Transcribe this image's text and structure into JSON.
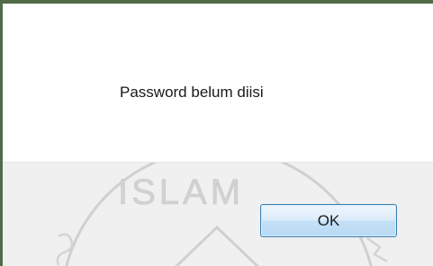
{
  "dialog": {
    "message": "Password belum diisi",
    "ok_label": "OK",
    "watermark_text": "ISLAM"
  },
  "colors": {
    "frame_border": "#4f6b48",
    "content_bg": "#ffffff",
    "button_area_bg": "#f0f0f0",
    "button_border": "#3c7fb1",
    "watermark": "#cfcfcf"
  }
}
